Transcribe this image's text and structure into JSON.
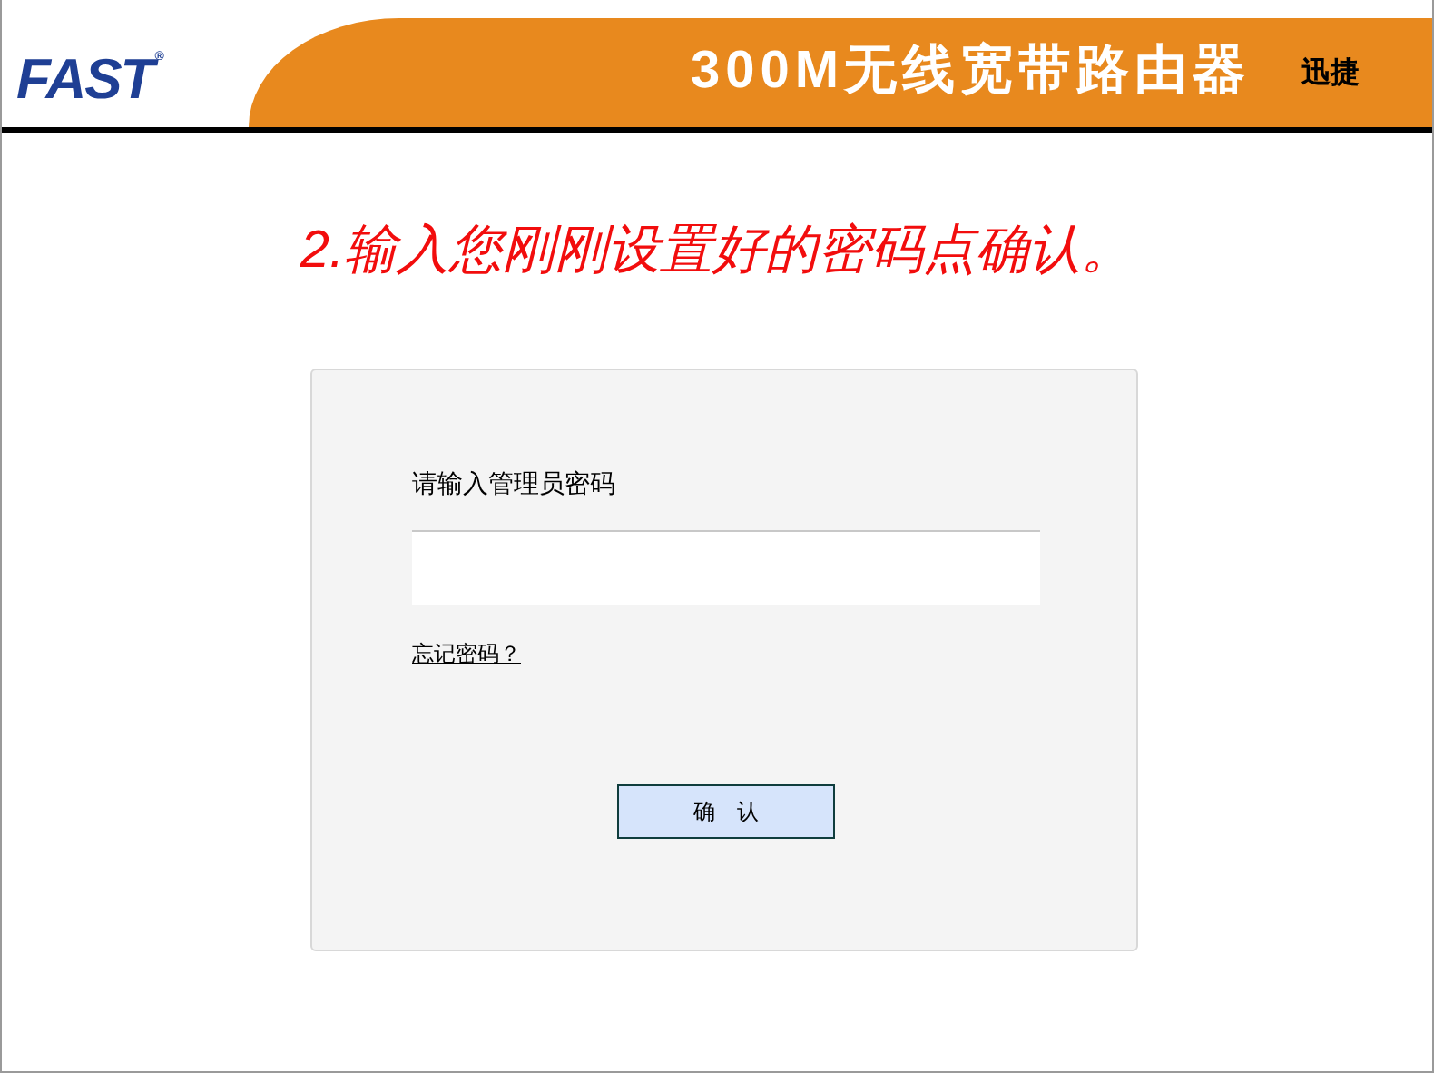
{
  "header": {
    "logo": "FAST",
    "logo_mark": "®",
    "title": "300M无线宽带路由器",
    "brand": "迅捷"
  },
  "instruction": "2.输入您刚刚设置好的密码点确认。",
  "login": {
    "label": "请输入管理员密码",
    "forgot_link": "忘记密码？",
    "confirm_button": "确　认"
  }
}
